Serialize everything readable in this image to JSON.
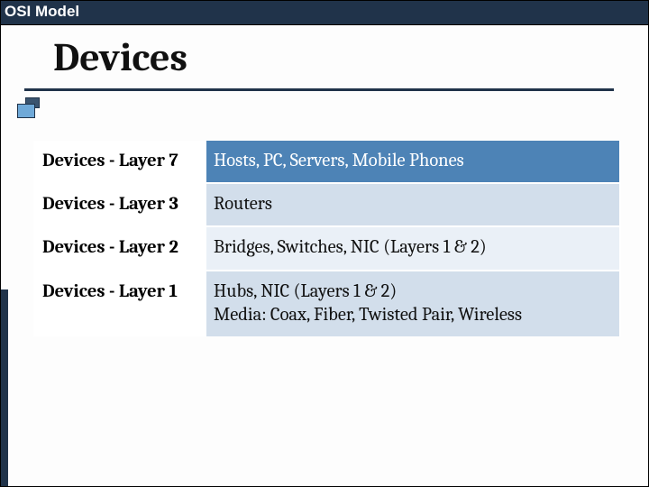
{
  "header": {
    "title": "OSI Model"
  },
  "slide": {
    "title": "Devices"
  },
  "table": {
    "rows": [
      {
        "label": "Devices - Layer 7",
        "value": "Hosts, PC, Servers, Mobile Phones"
      },
      {
        "label": "Devices - Layer 3",
        "value": "Routers"
      },
      {
        "label": "Devices - Layer 2",
        "value": "Bridges, Switches, NIC (Layers 1 & 2)"
      },
      {
        "label": "Devices - Layer 1",
        "value": "Hubs, NIC (Layers 1 & 2)\nMedia: Coax, Fiber, Twisted Pair, Wireless"
      }
    ]
  },
  "colors": {
    "header_bg": "#20334a",
    "row_primary": "#4d83b6",
    "row_alt_a": "#d2deeb",
    "row_alt_b": "#eaf0f7"
  }
}
